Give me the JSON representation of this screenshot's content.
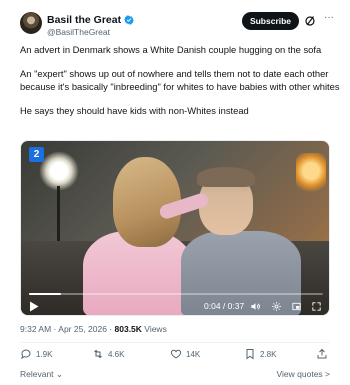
{
  "author": {
    "name": "Basil the Great",
    "handle": "@BasilTheGreat",
    "subscribe_label": "Subscribe",
    "more_label": "···"
  },
  "tweet": {
    "paragraphs": [
      "An advert in Denmark shows a White Danish couple hugging on the sofa",
      "An \"expert\" shows up out of nowhere and tells them not to date each other because it's basically \"inbreeding\" for whites to have babies with other whites",
      "He says they should have kids with non-Whites instead"
    ]
  },
  "video": {
    "channel_badge": "2",
    "timecode": "0:04 / 0:37",
    "progress": 0.11
  },
  "meta": {
    "time": "9:32 AM · Apr 25, 2026 · ",
    "views_count": "803.5K",
    "views_label": " Views"
  },
  "actions": {
    "replies": "1.9K",
    "reposts": "4.6K",
    "likes": "14K",
    "bookmarks": "2.8K"
  },
  "footer": {
    "relevant_label": "Relevant ⌄",
    "view_quotes_label": "View quotes >"
  },
  "colors": {
    "accent": "#1d9bf0",
    "text": "#0f1419",
    "muted": "#536471",
    "repost": "#536471",
    "badge": "#1d6fe0"
  }
}
